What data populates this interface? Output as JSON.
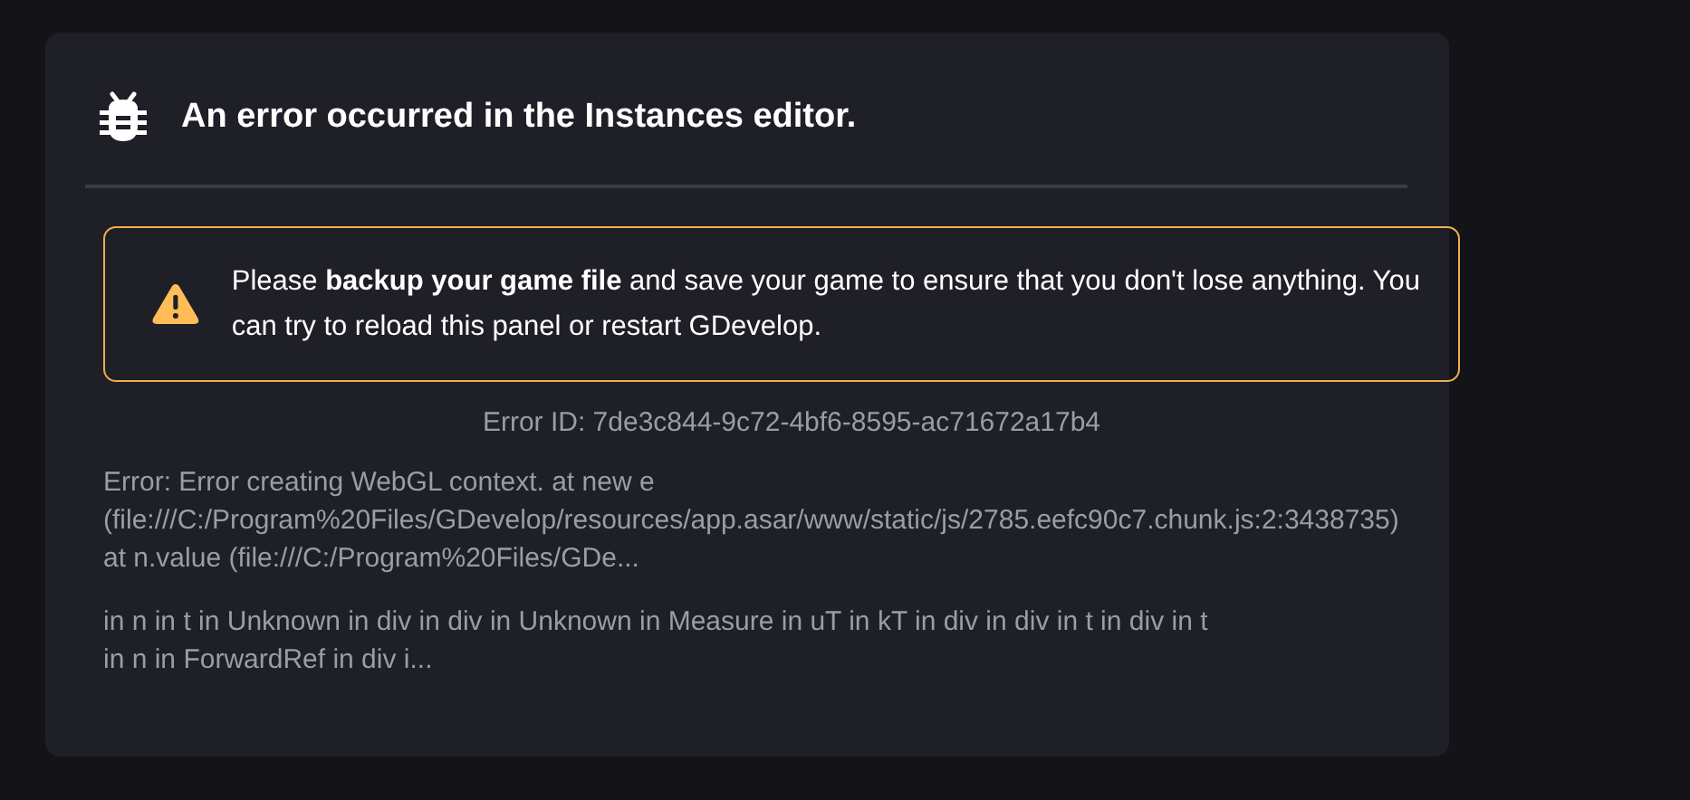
{
  "title": "An error occurred in the Instances editor.",
  "warning": {
    "message": "Please **backup your game file** and save your game to ensure that you don't lose anything. You can try to reload this panel or restart GDevelop."
  },
  "error_id": "Error ID: 7de3c844-9c72-4bf6-8595-ac71672a17b4",
  "error_stack": "Error: Error creating WebGL context. at new e\n(file:///C:/Program%20Files/GDevelop/resources/app.asar/www/static/js/2785.eefc90c7.chunk.js:2:3438735)\nat n.value (file:///C:/Program%20Files/GDe...",
  "component_stack": "in n in t in Unknown in div in div in Unknown in Measure in uT in kT in div in div in t in div in t\nin n in ForwardRef in div i..."
}
